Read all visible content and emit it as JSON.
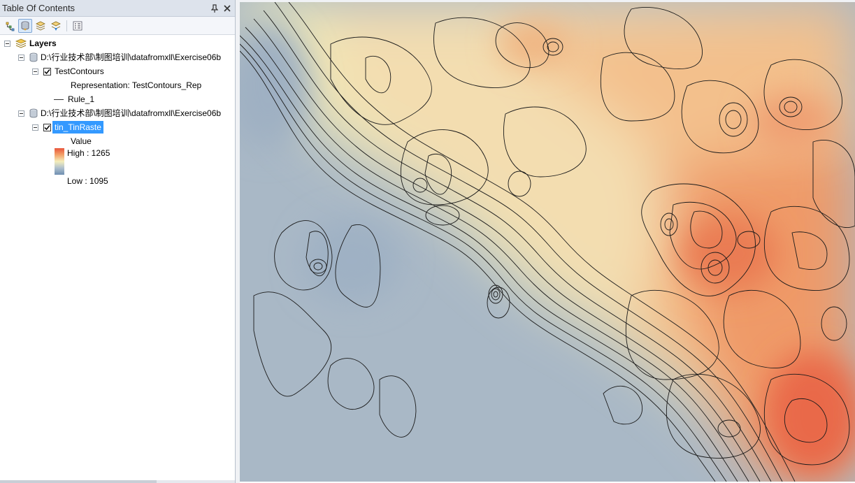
{
  "toc": {
    "title": "Table Of Contents",
    "pin_label": "ᵽ",
    "close_label": "✕",
    "toolbar": [
      {
        "icon": "list-by-drawing-order-icon",
        "active": false
      },
      {
        "icon": "list-by-source-icon",
        "active": true
      },
      {
        "icon": "list-by-visibility-icon",
        "active": false
      },
      {
        "icon": "list-by-selection-icon",
        "active": false
      },
      {
        "icon": "options-icon",
        "active": false
      }
    ],
    "layers_root": "Layers",
    "datasource_1": "D:\\行业技术部\\制图培训\\datafromxll\\Exercise06b",
    "contours": {
      "name": "TestContours",
      "representation": "Representation: TestContours_Rep",
      "rule": "Rule_1"
    },
    "datasource_2": "D:\\行业技术部\\制图培训\\datafromxll\\Exercise06b",
    "raster": {
      "name": "tin_TinRaste",
      "value_label": "Value",
      "high_label": "High : 1265",
      "low_label": "Low : 1095"
    }
  },
  "colors": {
    "ramp_high": "#e8553a",
    "ramp_mid": "#f4eebb",
    "ramp_low": "#6f8fb1",
    "selection": "#3399ff"
  }
}
